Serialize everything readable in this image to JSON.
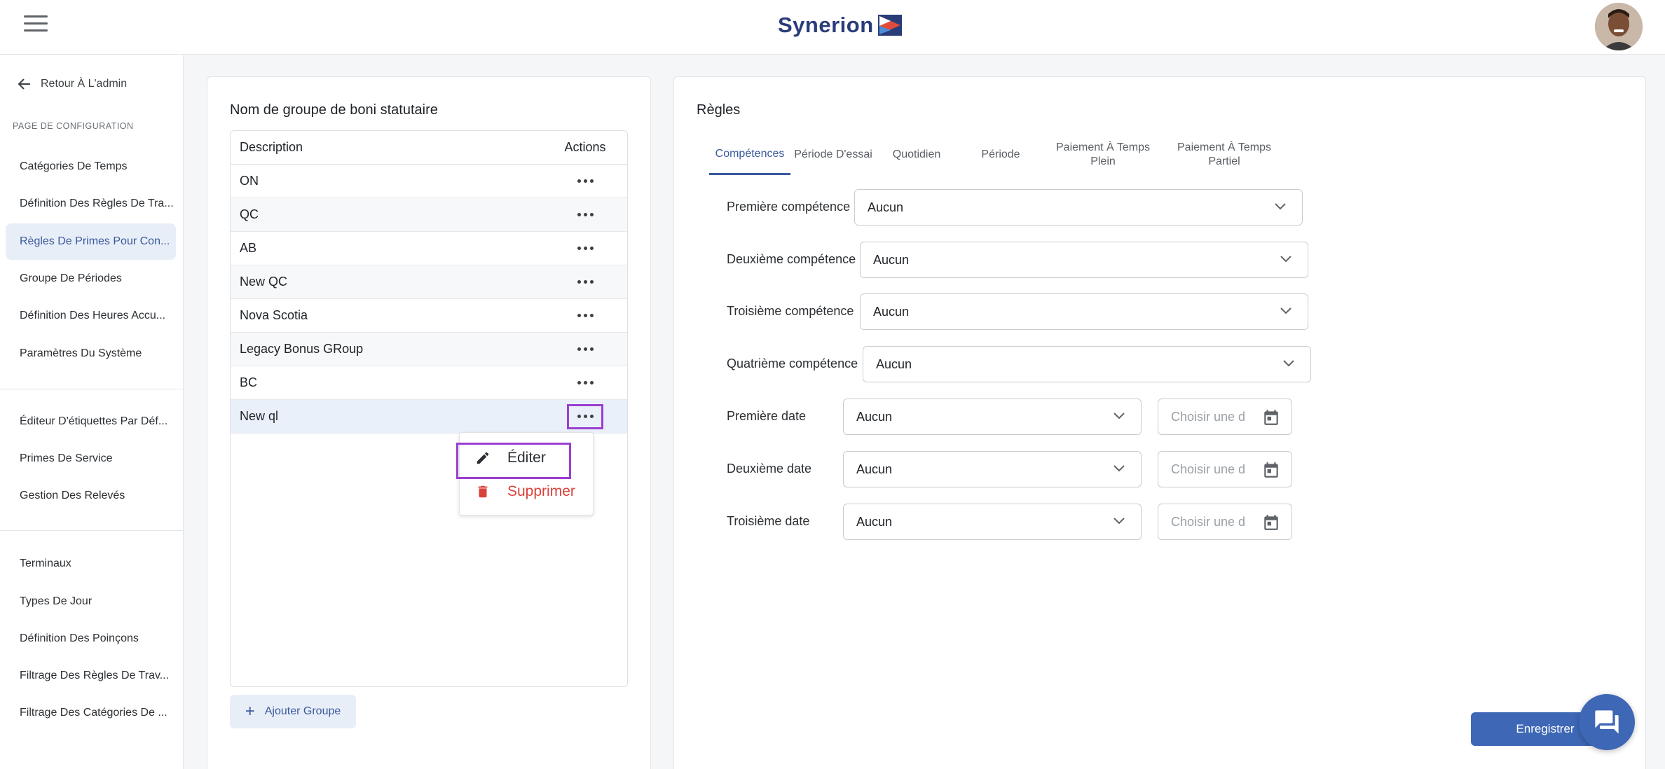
{
  "header": {
    "brand": "Synerion",
    "colors": {
      "brand": "#2a3d7a",
      "accent": "#3e67b6",
      "highlight": "#9b3fd1",
      "danger": "#d9423a"
    }
  },
  "sidebar": {
    "back_label": "Retour À L'admin",
    "section_label": "PAGE DE CONFIGURATION",
    "items": [
      "Catégories De Temps",
      "Définition Des Règles De Tra...",
      "Règles De Primes Pour Con...",
      "Groupe De Périodes",
      "Définition Des Heures Accu...",
      "Paramètres Du Système",
      "Éditeur D'étiquettes Par Déf...",
      "Primes De Service",
      "Gestion Des Relevés",
      "Terminaux",
      "Types De Jour",
      "Définition Des Poinçons",
      "Filtrage Des Règles De Trav...",
      "Filtrage Des Catégories De ..."
    ]
  },
  "groups": {
    "title": "Nom de groupe de boni statutaire",
    "col_description": "Description",
    "col_actions": "Actions",
    "rows": [
      "ON",
      "QC",
      "AB",
      "New QC",
      "Nova Scotia",
      "Legacy Bonus GRoup",
      "BC",
      "New ql"
    ],
    "menu": {
      "edit": "Éditer",
      "delete": "Supprimer"
    },
    "add_button": "Ajouter Groupe"
  },
  "rules": {
    "title": "Règles",
    "tabs": [
      "Compétences",
      "Période D'essai",
      "Quotidien",
      "Période",
      "Paiement À Temps Plein",
      "Paiement À Temps Partiel"
    ],
    "fields": [
      {
        "label": "Première compétence",
        "value": "Aucun"
      },
      {
        "label": "Deuxième compétence",
        "value": "Aucun"
      },
      {
        "label": "Troisième compétence",
        "value": "Aucun"
      },
      {
        "label": "Quatrième compétence",
        "value": "Aucun"
      }
    ],
    "dates": [
      {
        "label": "Première date",
        "value": "Aucun",
        "placeholder": "Choisir une d"
      },
      {
        "label": "Deuxième date",
        "value": "Aucun",
        "placeholder": "Choisir une d"
      },
      {
        "label": "Troisième date",
        "value": "Aucun",
        "placeholder": "Choisir une d"
      }
    ],
    "save_button": "Enregistrer"
  }
}
